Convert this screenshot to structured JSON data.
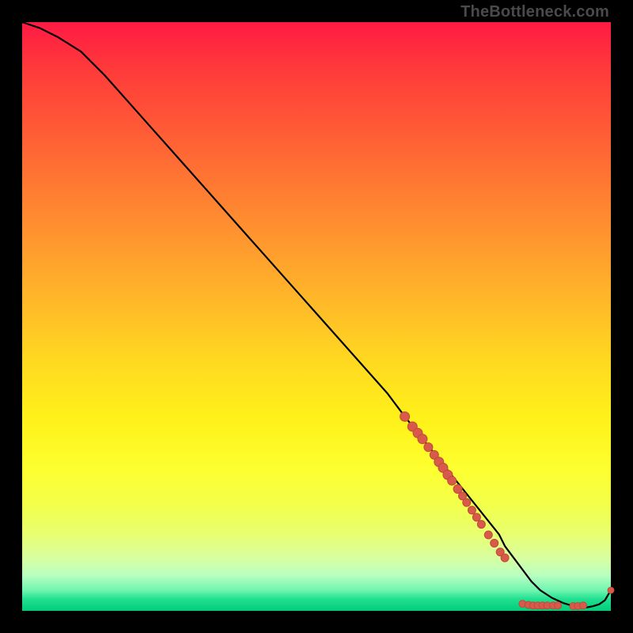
{
  "watermark": "TheBottleneck.com",
  "chart_data": {
    "type": "line",
    "title": "",
    "xlabel": "",
    "ylabel": "",
    "xlim": [
      0,
      100
    ],
    "ylim": [
      0,
      100
    ],
    "curve": {
      "name": "bottleneck-curve",
      "x": [
        0,
        3,
        6,
        10,
        14,
        18,
        22,
        26,
        30,
        34,
        38,
        42,
        46,
        50,
        54,
        58,
        62,
        65,
        67,
        69,
        71,
        73,
        75,
        77,
        79,
        81,
        82,
        83.5,
        85,
        86.5,
        88,
        90,
        92,
        94,
        96,
        97,
        98,
        99,
        100
      ],
      "y": [
        100,
        99,
        97.5,
        95,
        91,
        86.5,
        82,
        77.5,
        73,
        68.5,
        64,
        59.5,
        55,
        50.5,
        46,
        41.5,
        37,
        33,
        30.5,
        28,
        25.5,
        23,
        20.5,
        18,
        15.5,
        13,
        11,
        9,
        7,
        5,
        3.5,
        2.2,
        1.3,
        0.7,
        0.6,
        0.8,
        1.1,
        1.8,
        3.5
      ]
    },
    "markers": {
      "name": "data-points",
      "points": [
        {
          "x": 65,
          "y": 33,
          "r": 6
        },
        {
          "x": 66.3,
          "y": 31.3,
          "r": 6
        },
        {
          "x": 67.2,
          "y": 30.2,
          "r": 6
        },
        {
          "x": 68,
          "y": 29.2,
          "r": 6
        },
        {
          "x": 69,
          "y": 27.8,
          "r": 5.5
        },
        {
          "x": 70,
          "y": 26.5,
          "r": 5.5
        },
        {
          "x": 70.8,
          "y": 25.3,
          "r": 6
        },
        {
          "x": 71.5,
          "y": 24.3,
          "r": 6
        },
        {
          "x": 72.3,
          "y": 23.1,
          "r": 6
        },
        {
          "x": 73,
          "y": 22.1,
          "r": 5.5
        },
        {
          "x": 74,
          "y": 20.7,
          "r": 5.5
        },
        {
          "x": 74.8,
          "y": 19.5,
          "r": 5
        },
        {
          "x": 75.5,
          "y": 18.4,
          "r": 5
        },
        {
          "x": 76.4,
          "y": 17.1,
          "r": 5
        },
        {
          "x": 77.2,
          "y": 15.9,
          "r": 5
        },
        {
          "x": 78,
          "y": 14.7,
          "r": 5
        },
        {
          "x": 79.2,
          "y": 12.9,
          "r": 5
        },
        {
          "x": 80.2,
          "y": 11.5,
          "r": 5
        },
        {
          "x": 81.2,
          "y": 10,
          "r": 5
        },
        {
          "x": 82,
          "y": 9,
          "r": 5
        },
        {
          "x": 85,
          "y": 1.2,
          "r": 4.5
        },
        {
          "x": 86,
          "y": 1,
          "r": 4.5
        },
        {
          "x": 86.8,
          "y": 0.9,
          "r": 4.5
        },
        {
          "x": 87.6,
          "y": 0.9,
          "r": 4.5
        },
        {
          "x": 88.4,
          "y": 0.9,
          "r": 4.5
        },
        {
          "x": 89.2,
          "y": 0.9,
          "r": 4.5
        },
        {
          "x": 90.2,
          "y": 0.9,
          "r": 4.5
        },
        {
          "x": 91,
          "y": 0.9,
          "r": 4.5
        },
        {
          "x": 93.6,
          "y": 0.8,
          "r": 4.5
        },
        {
          "x": 94.4,
          "y": 0.8,
          "r": 4.5
        },
        {
          "x": 95.3,
          "y": 0.9,
          "r": 4.5
        },
        {
          "x": 100,
          "y": 3.5,
          "r": 4
        }
      ]
    }
  }
}
